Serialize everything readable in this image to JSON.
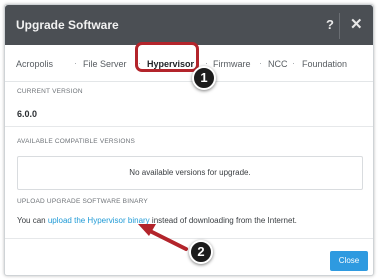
{
  "dialog": {
    "title": "Upgrade Software",
    "help_icon": "?",
    "close_icon": "✕"
  },
  "tabs": [
    {
      "label": "Acropolis",
      "active": false
    },
    {
      "label": "File Server",
      "active": false
    },
    {
      "label": "Hypervisor",
      "active": true
    },
    {
      "label": "Firmware",
      "active": false
    },
    {
      "label": "NCC",
      "active": false
    },
    {
      "label": "Foundation",
      "active": false
    }
  ],
  "tab_separator": "·",
  "current_version": {
    "label": "CURRENT VERSION",
    "value": "6.0.0"
  },
  "compatible_versions": {
    "label": "AVAILABLE COMPATIBLE VERSIONS",
    "empty_message": "No available versions for upgrade."
  },
  "upload": {
    "label": "UPLOAD UPGRADE SOFTWARE BINARY",
    "prefix": "You can ",
    "link_text": "upload the Hypervisor binary",
    "suffix": " instead of downloading from the Internet."
  },
  "footer": {
    "close_label": "Close"
  },
  "annotations": [
    {
      "number": "1"
    },
    {
      "number": "2"
    }
  ],
  "colors": {
    "titlebar": "#4b4f54",
    "highlight_red": "#b3242b",
    "link_blue": "#1f9ad6",
    "button_blue": "#2e9ae0"
  }
}
